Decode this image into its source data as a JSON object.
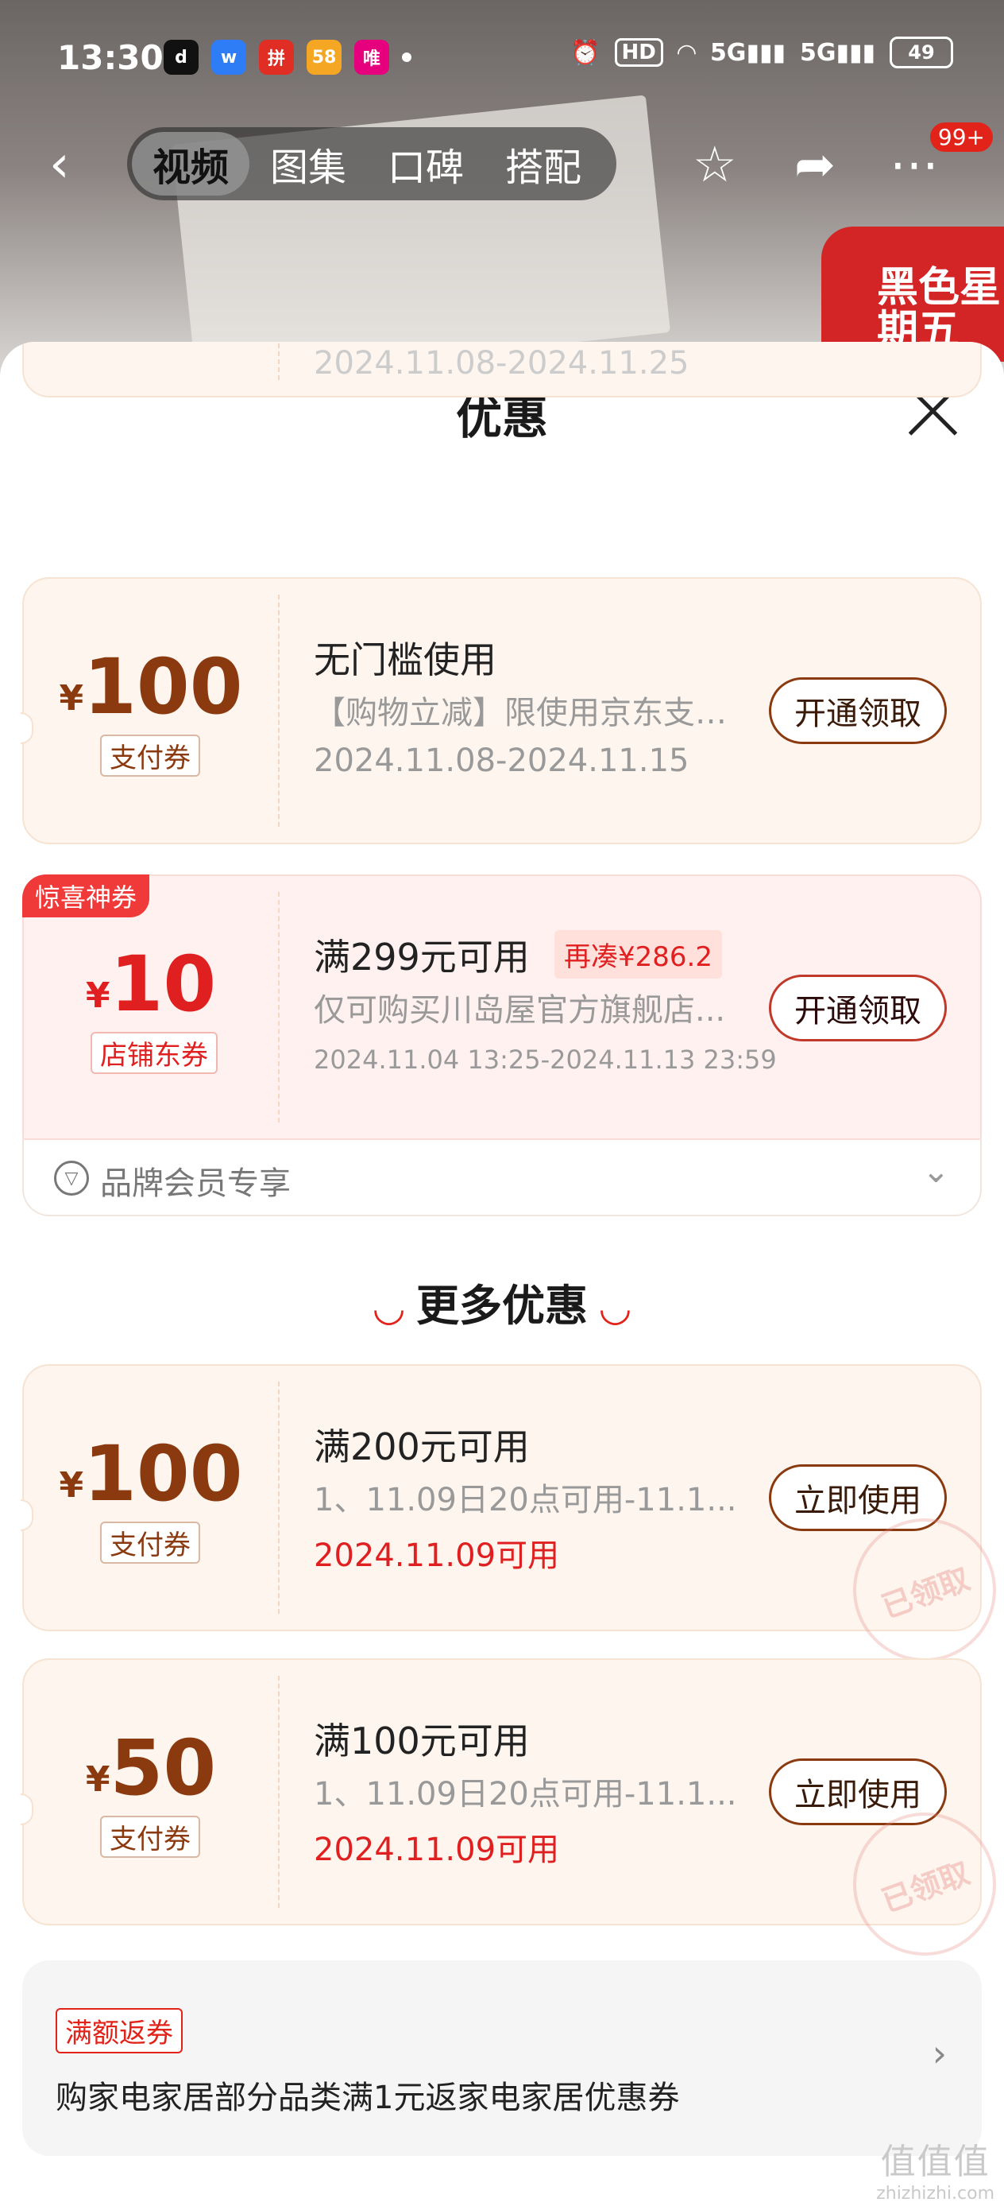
{
  "status_bar": {
    "time": "13:30",
    "apps": [
      "tiktok",
      "wallet",
      "pinduoduo",
      "58",
      "vip"
    ],
    "app_labels": [
      "d",
      "w",
      "拼",
      "58",
      "唯"
    ],
    "hd": "HD",
    "signal_1": "5G",
    "signal_2": "5G",
    "battery": "49"
  },
  "nav": {
    "back_icon": "‹",
    "tabs": [
      "视频",
      "图集",
      "口碑",
      "搭配"
    ],
    "active_tab": "视频",
    "badge": "99+"
  },
  "background": {
    "promo_text": "黑色星期五"
  },
  "sheet": {
    "title": "优惠",
    "partial_date": "2024.11.08-2024.11.25",
    "coupons": [
      {
        "currency": "¥",
        "amount": "100",
        "tag": "支付券",
        "title": "无门槛使用",
        "desc": "【购物立减】限使用京东支付...",
        "date": "2024.11.08-2024.11.15",
        "button": "开通领取"
      },
      {
        "badge": "惊喜神券",
        "currency": "¥",
        "amount": "10",
        "tag": "店铺东券",
        "title": "满299元可用",
        "need": "再凑¥286.2",
        "desc": "仅可购买川岛屋官方旗舰店...",
        "date": "2024.11.04 13:25-2024.11.13 23:59",
        "button": "开通领取"
      }
    ],
    "member": {
      "icon": "▽",
      "label": "品牌会员专享",
      "chevron": "⌄"
    },
    "more_title": "更多优惠",
    "more_coupons": [
      {
        "currency": "¥",
        "amount": "100",
        "tag": "支付券",
        "title": "满200元可用",
        "desc": "1、11.09日20点可用-11.1...",
        "date": "2024.11.09可用",
        "button": "立即使用",
        "stamp": "已领取"
      },
      {
        "currency": "¥",
        "amount": "50",
        "tag": "支付券",
        "title": "满100元可用",
        "desc": "1、11.09日20点可用-11.1...",
        "date": "2024.11.09可用",
        "button": "立即使用",
        "stamp": "已领取"
      }
    ],
    "rebate": {
      "tag": "满额返券",
      "text": "购家电家居部分品类满1元返家电家居优惠券",
      "chevron": "›"
    }
  },
  "watermark": {
    "line1": "值值值",
    "line2": "zhizhizhi.com"
  },
  "colors": {
    "accent": "#e2231a",
    "coupon_brown": "#8b3a10",
    "coupon_bg": "#fdf5ee"
  }
}
